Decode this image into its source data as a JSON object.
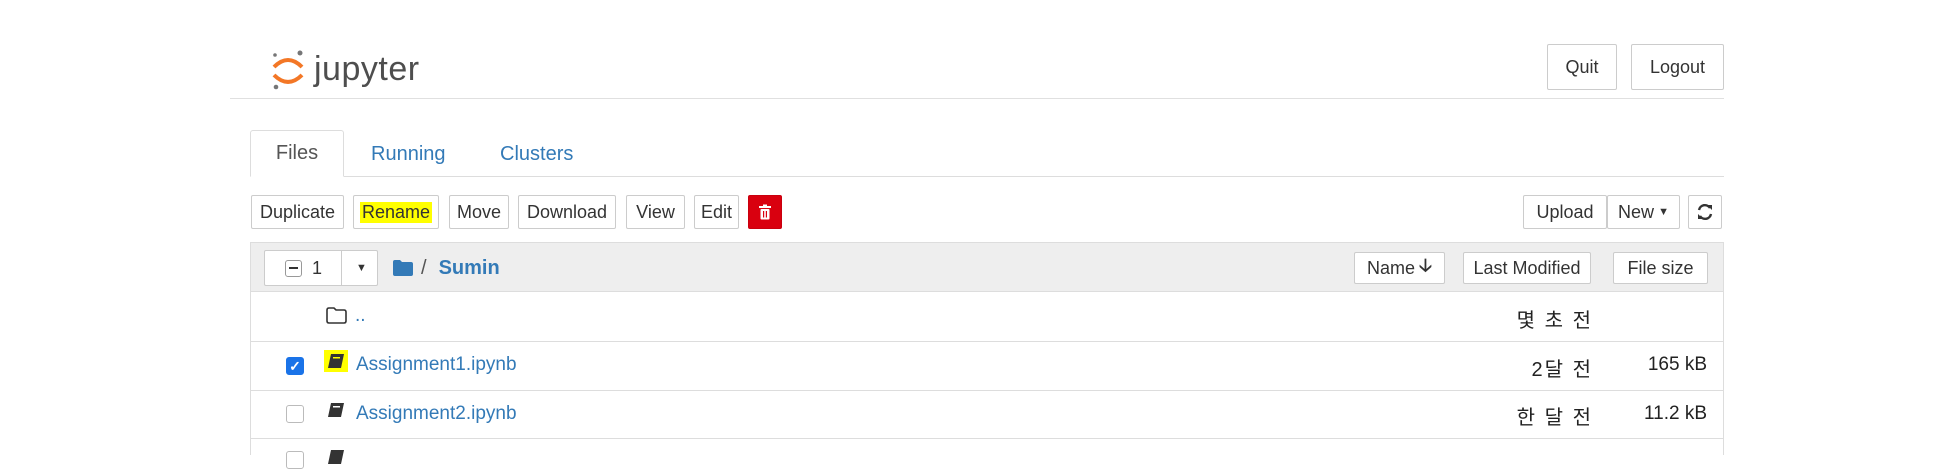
{
  "header": {
    "logo_text": "jupyter",
    "quit_label": "Quit",
    "logout_label": "Logout"
  },
  "tabs": [
    {
      "label": "Files",
      "active": true
    },
    {
      "label": "Running",
      "active": false
    },
    {
      "label": "Clusters",
      "active": false
    }
  ],
  "toolbar": {
    "duplicate": "Duplicate",
    "rename": "Rename",
    "move": "Move",
    "download": "Download",
    "view": "View",
    "edit": "Edit",
    "upload": "Upload",
    "new": "New"
  },
  "list_header": {
    "select_count": "1",
    "breadcrumb_sep": "/",
    "folder_name": "Sumin",
    "sort_name": "Name",
    "sort_modified": "Last Modified",
    "sort_size": "File size"
  },
  "rows": [
    {
      "name": "..",
      "modified": "몇 초 전",
      "size": "",
      "checked": false
    },
    {
      "name": "Assignment1.ipynb",
      "modified": "2달 전",
      "size": "165 kB",
      "checked": true
    },
    {
      "name": "Assignment2.ipynb",
      "modified": "한 달 전",
      "size": "11.2 kB",
      "checked": false
    }
  ],
  "colors": {
    "accent": "#337ab7",
    "highlight": "#ffff00",
    "delete": "#d9000f",
    "logo_orange": "#f37726"
  }
}
